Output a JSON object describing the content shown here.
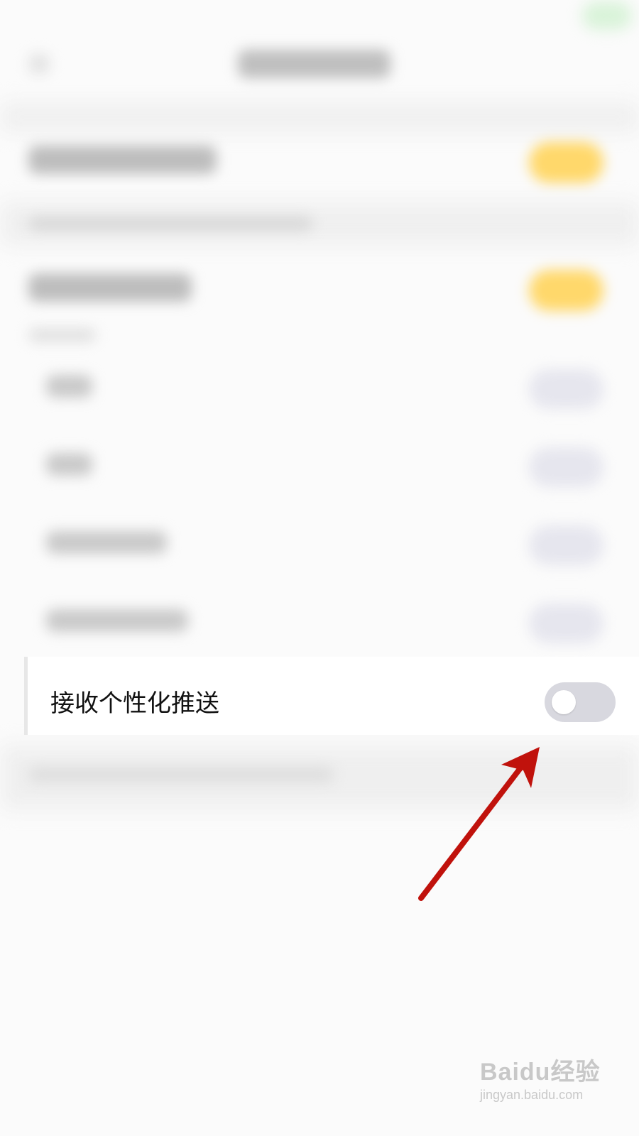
{
  "setting": {
    "label": "接收个性化推送",
    "toggle_on": false
  },
  "colors": {
    "toggle_off_track": "#d8d8df",
    "toggle_on_accent": "#ffd86b",
    "annotation_arrow": "#c0120c"
  },
  "watermark": {
    "brand": "Baidu经验",
    "url": "jingyan.baidu.com"
  },
  "icons": {
    "back": "back-arrow-icon",
    "annotation": "red-arrow-annotation"
  }
}
